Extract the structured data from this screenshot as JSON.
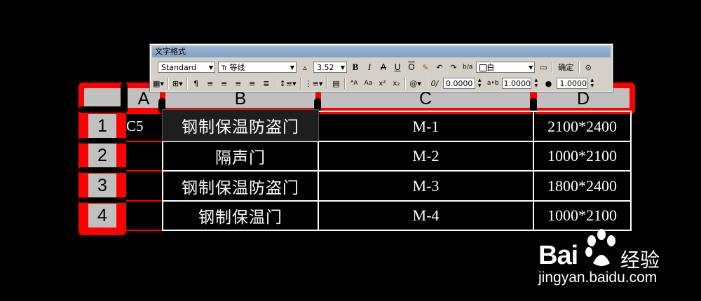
{
  "toolbar": {
    "title": "文字格式",
    "style": "Standard",
    "font": "等线",
    "font_icon": "Tr",
    "height": "3.52",
    "bold": "B",
    "italic": "I",
    "strike": "A",
    "underline": "U",
    "overline": "O",
    "stack": "b/a",
    "color": "白",
    "ok_label": "确定",
    "oblique": "0.0000",
    "tracking": "1.0000",
    "width": "1.0000",
    "at_label": "@",
    "sup": "x²",
    "sub": "x₂",
    "caps_upper": "ᴬA",
    "caps_lower": "Aa"
  },
  "table": {
    "col_headers": [
      "A",
      "B",
      "C",
      "D"
    ],
    "row_headers": [
      "1",
      "2",
      "3",
      "4"
    ],
    "rows": [
      {
        "a": "C5",
        "b": "钢制保温防盗门",
        "c": "M-1",
        "d": "2100*2400"
      },
      {
        "a": "",
        "b": "隔声门",
        "c": "M-2",
        "d": "1000*2100"
      },
      {
        "a": "",
        "b": "钢制保温防盗门",
        "c": "M-3",
        "d": "1800*2400"
      },
      {
        "a": "",
        "b": "钢制保温门",
        "c": "M-4",
        "d": "1000*2100"
      }
    ]
  },
  "watermark": {
    "brand_left": "Bai",
    "brand_right": "经验",
    "url": "jingyan.baidu.com"
  },
  "colors": {
    "frame": "#ff0000",
    "header_bg": "#c0c0c0",
    "editing_cell": "#1e1e1e"
  }
}
